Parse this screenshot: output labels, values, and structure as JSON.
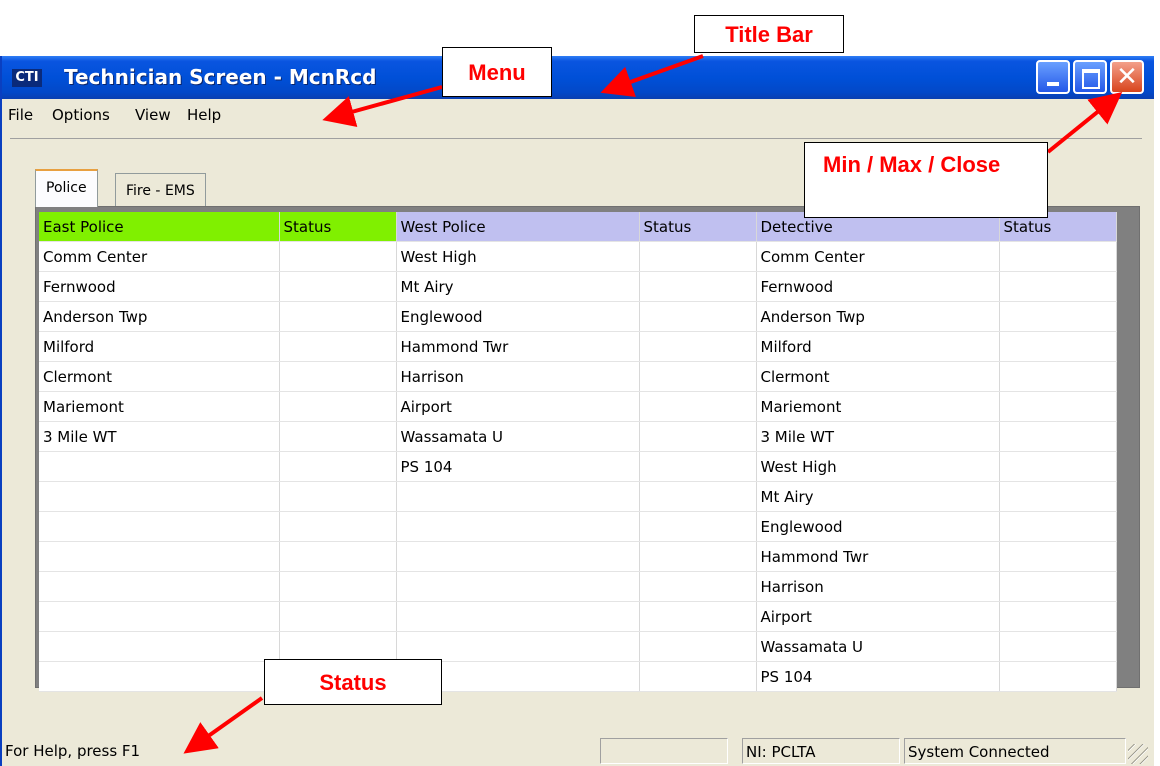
{
  "window": {
    "app_icon_label": "CTI",
    "title": "Technician Screen - McnRcd",
    "close_glyph": "✕"
  },
  "menu": [
    "File",
    "Options",
    "View",
    "Help"
  ],
  "tabs": [
    {
      "label": "Police",
      "active": true
    },
    {
      "label": "Fire - EMS",
      "active": false
    }
  ],
  "grid": {
    "headers": [
      "East Police",
      "Status",
      "West Police",
      "Status",
      "Detective",
      "Status"
    ],
    "header_colors": {
      "east": "#80f000",
      "west": "#c0c0f0",
      "detective": "#c0c0f0"
    },
    "east_police": [
      "Comm Center",
      "Fernwood",
      "Anderson Twp",
      "Milford",
      "Clermont",
      "Mariemont",
      "3 Mile WT",
      "",
      "",
      "",
      "",
      "",
      "",
      "",
      ""
    ],
    "west_police": [
      "West High",
      "Mt Airy",
      "Englewood",
      "Hammond Twr",
      "Harrison",
      "Airport",
      "Wassamata U",
      "PS 104",
      "",
      "",
      "",
      "",
      "",
      "",
      ""
    ],
    "detective": [
      "Comm Center",
      "Fernwood",
      "Anderson Twp",
      "Milford",
      "Clermont",
      "Mariemont",
      "3 Mile WT",
      "West High",
      "Mt Airy",
      "Englewood",
      "Hammond Twr",
      "Harrison",
      "Airport",
      "Wassamata U",
      "PS 104"
    ]
  },
  "statusbar": {
    "help_text": "For Help, press F1",
    "empty_pane": "",
    "ni": "NI: PCLTA",
    "connection": "System Connected"
  },
  "callouts": {
    "title_bar": "Title Bar",
    "menu": "Menu",
    "min_max_close": "Min / Max / Close",
    "status": "Status"
  },
  "colors": {
    "arrow": "#ff0000",
    "titlebar": "#0050d8"
  }
}
